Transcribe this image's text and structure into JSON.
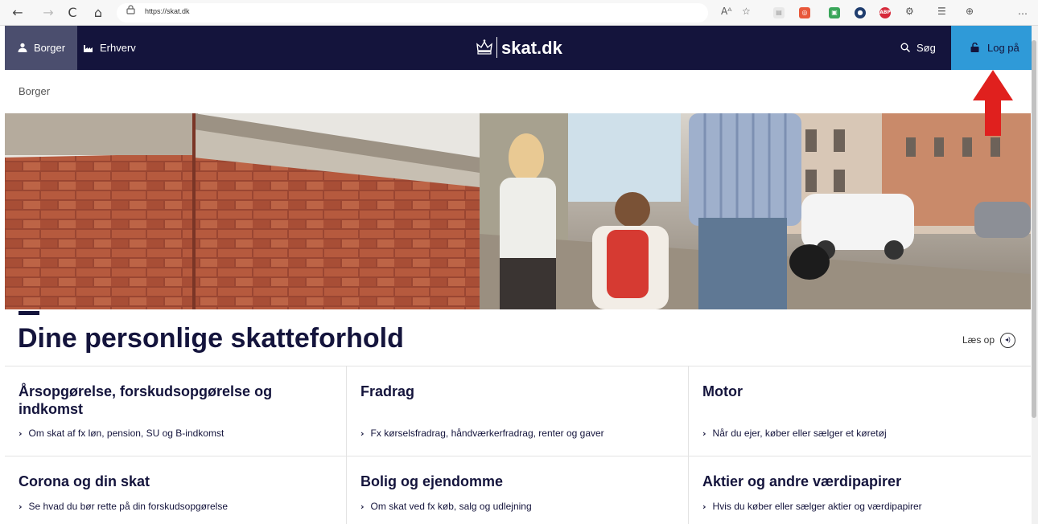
{
  "browser": {
    "url": "https://skat.dk",
    "back_icon": "←",
    "forward_icon": "→",
    "reload_icon": "C",
    "home_icon": "⌂",
    "lock_icon": "🔒",
    "tools": [
      "Aᴬ",
      "☆",
      "…"
    ]
  },
  "header": {
    "tabs": [
      {
        "label": "Borger",
        "icon": "person-icon"
      },
      {
        "label": "Erhverv",
        "icon": "factory-icon"
      }
    ],
    "logo_text": "skat.dk",
    "search_label": "Søg",
    "login_label": "Log på",
    "colors": {
      "navy": "#14143c",
      "active_tab": "#4b4e6e",
      "login_bg": "#2f9ad8",
      "arrow": "#e0201e"
    }
  },
  "breadcrumb": "Borger",
  "page_title": "Dine personlige skatteforhold",
  "read_aloud": "Læs op",
  "categories": [
    {
      "title": "Årsopgørelse, forskudsopgørelse og indkomst",
      "link": "Om skat af fx løn, pension, SU og B-indkomst"
    },
    {
      "title": "Fradrag",
      "link": "Fx kørselsfradrag, håndværkerfradrag, renter og gaver"
    },
    {
      "title": "Motor",
      "link": "Når du ejer, køber eller sælger et køretøj"
    },
    {
      "title": "Corona og din skat",
      "link": "Se hvad du bør rette på din forskudsopgørelse"
    },
    {
      "title": "Bolig og ejendomme",
      "link": "Om skat ved fx køb, salg og udlejning"
    },
    {
      "title": "Aktier og andre værdipapirer",
      "link": "Hvis du køber eller sælger aktier og værdipapirer"
    }
  ]
}
